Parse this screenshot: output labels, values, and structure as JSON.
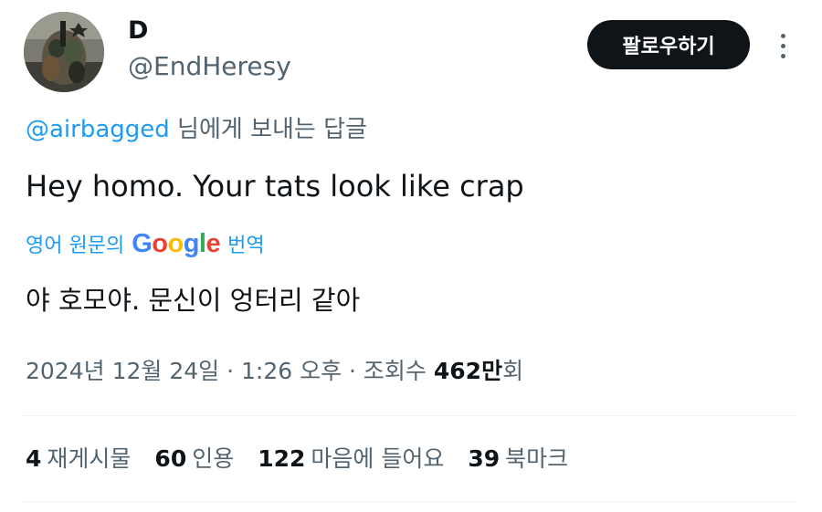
{
  "author": {
    "display_name": "D",
    "handle": "@EndHeresy"
  },
  "follow_button_label": "팔로우하기",
  "reply_context": {
    "mention": "@airbagged",
    "suffix": " 님에게 보내는 답글"
  },
  "tweet_text": "Hey homo. Your tats look like crap",
  "translation": {
    "prefix": "영어 원문의",
    "provider": "Google",
    "suffix": "번역",
    "translated_text": "야 호모야. 문신이 엉터리 같아"
  },
  "meta": {
    "date": "2024년 12월 24일",
    "separator": " · ",
    "time": "1:26 오후",
    "views_label": "조회수",
    "views_count": "462만",
    "views_suffix": "회"
  },
  "stats": [
    {
      "count": "4",
      "label": "재게시물"
    },
    {
      "count": "60",
      "label": "인용"
    },
    {
      "count": "122",
      "label": "마음에 들어요"
    },
    {
      "count": "39",
      "label": "북마크"
    }
  ],
  "colors": {
    "link_blue": "#1d9bf0",
    "secondary_text": "#536471",
    "primary_text": "#0f1419",
    "follow_button_bg": "#0f1419",
    "google_blue": "#4285F4",
    "google_red": "#EA4335",
    "google_yellow": "#FBBC05",
    "google_green": "#34A853"
  }
}
